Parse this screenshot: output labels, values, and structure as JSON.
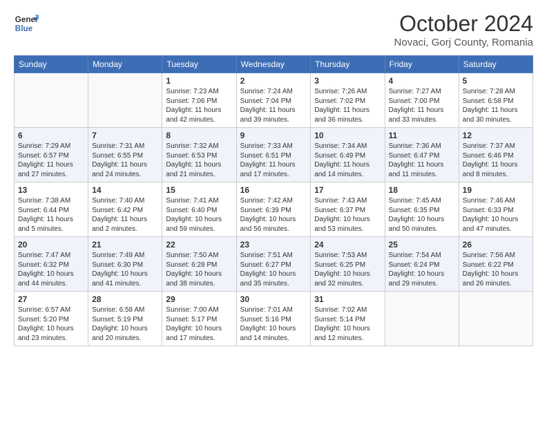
{
  "header": {
    "logo_line1": "General",
    "logo_line2": "Blue",
    "month": "October 2024",
    "location": "Novaci, Gorj County, Romania"
  },
  "weekdays": [
    "Sunday",
    "Monday",
    "Tuesday",
    "Wednesday",
    "Thursday",
    "Friday",
    "Saturday"
  ],
  "rows": [
    [
      {
        "day": "",
        "sunrise": "",
        "sunset": "",
        "daylight": ""
      },
      {
        "day": "",
        "sunrise": "",
        "sunset": "",
        "daylight": ""
      },
      {
        "day": "1",
        "sunrise": "Sunrise: 7:23 AM",
        "sunset": "Sunset: 7:06 PM",
        "daylight": "Daylight: 11 hours and 42 minutes."
      },
      {
        "day": "2",
        "sunrise": "Sunrise: 7:24 AM",
        "sunset": "Sunset: 7:04 PM",
        "daylight": "Daylight: 11 hours and 39 minutes."
      },
      {
        "day": "3",
        "sunrise": "Sunrise: 7:26 AM",
        "sunset": "Sunset: 7:02 PM",
        "daylight": "Daylight: 11 hours and 36 minutes."
      },
      {
        "day": "4",
        "sunrise": "Sunrise: 7:27 AM",
        "sunset": "Sunset: 7:00 PM",
        "daylight": "Daylight: 11 hours and 33 minutes."
      },
      {
        "day": "5",
        "sunrise": "Sunrise: 7:28 AM",
        "sunset": "Sunset: 6:58 PM",
        "daylight": "Daylight: 11 hours and 30 minutes."
      }
    ],
    [
      {
        "day": "6",
        "sunrise": "Sunrise: 7:29 AM",
        "sunset": "Sunset: 6:57 PM",
        "daylight": "Daylight: 11 hours and 27 minutes."
      },
      {
        "day": "7",
        "sunrise": "Sunrise: 7:31 AM",
        "sunset": "Sunset: 6:55 PM",
        "daylight": "Daylight: 11 hours and 24 minutes."
      },
      {
        "day": "8",
        "sunrise": "Sunrise: 7:32 AM",
        "sunset": "Sunset: 6:53 PM",
        "daylight": "Daylight: 11 hours and 21 minutes."
      },
      {
        "day": "9",
        "sunrise": "Sunrise: 7:33 AM",
        "sunset": "Sunset: 6:51 PM",
        "daylight": "Daylight: 11 hours and 17 minutes."
      },
      {
        "day": "10",
        "sunrise": "Sunrise: 7:34 AM",
        "sunset": "Sunset: 6:49 PM",
        "daylight": "Daylight: 11 hours and 14 minutes."
      },
      {
        "day": "11",
        "sunrise": "Sunrise: 7:36 AM",
        "sunset": "Sunset: 6:47 PM",
        "daylight": "Daylight: 11 hours and 11 minutes."
      },
      {
        "day": "12",
        "sunrise": "Sunrise: 7:37 AM",
        "sunset": "Sunset: 6:46 PM",
        "daylight": "Daylight: 11 hours and 8 minutes."
      }
    ],
    [
      {
        "day": "13",
        "sunrise": "Sunrise: 7:38 AM",
        "sunset": "Sunset: 6:44 PM",
        "daylight": "Daylight: 11 hours and 5 minutes."
      },
      {
        "day": "14",
        "sunrise": "Sunrise: 7:40 AM",
        "sunset": "Sunset: 6:42 PM",
        "daylight": "Daylight: 11 hours and 2 minutes."
      },
      {
        "day": "15",
        "sunrise": "Sunrise: 7:41 AM",
        "sunset": "Sunset: 6:40 PM",
        "daylight": "Daylight: 10 hours and 59 minutes."
      },
      {
        "day": "16",
        "sunrise": "Sunrise: 7:42 AM",
        "sunset": "Sunset: 6:39 PM",
        "daylight": "Daylight: 10 hours and 56 minutes."
      },
      {
        "day": "17",
        "sunrise": "Sunrise: 7:43 AM",
        "sunset": "Sunset: 6:37 PM",
        "daylight": "Daylight: 10 hours and 53 minutes."
      },
      {
        "day": "18",
        "sunrise": "Sunrise: 7:45 AM",
        "sunset": "Sunset: 6:35 PM",
        "daylight": "Daylight: 10 hours and 50 minutes."
      },
      {
        "day": "19",
        "sunrise": "Sunrise: 7:46 AM",
        "sunset": "Sunset: 6:33 PM",
        "daylight": "Daylight: 10 hours and 47 minutes."
      }
    ],
    [
      {
        "day": "20",
        "sunrise": "Sunrise: 7:47 AM",
        "sunset": "Sunset: 6:32 PM",
        "daylight": "Daylight: 10 hours and 44 minutes."
      },
      {
        "day": "21",
        "sunrise": "Sunrise: 7:49 AM",
        "sunset": "Sunset: 6:30 PM",
        "daylight": "Daylight: 10 hours and 41 minutes."
      },
      {
        "day": "22",
        "sunrise": "Sunrise: 7:50 AM",
        "sunset": "Sunset: 6:28 PM",
        "daylight": "Daylight: 10 hours and 38 minutes."
      },
      {
        "day": "23",
        "sunrise": "Sunrise: 7:51 AM",
        "sunset": "Sunset: 6:27 PM",
        "daylight": "Daylight: 10 hours and 35 minutes."
      },
      {
        "day": "24",
        "sunrise": "Sunrise: 7:53 AM",
        "sunset": "Sunset: 6:25 PM",
        "daylight": "Daylight: 10 hours and 32 minutes."
      },
      {
        "day": "25",
        "sunrise": "Sunrise: 7:54 AM",
        "sunset": "Sunset: 6:24 PM",
        "daylight": "Daylight: 10 hours and 29 minutes."
      },
      {
        "day": "26",
        "sunrise": "Sunrise: 7:56 AM",
        "sunset": "Sunset: 6:22 PM",
        "daylight": "Daylight: 10 hours and 26 minutes."
      }
    ],
    [
      {
        "day": "27",
        "sunrise": "Sunrise: 6:57 AM",
        "sunset": "Sunset: 5:20 PM",
        "daylight": "Daylight: 10 hours and 23 minutes."
      },
      {
        "day": "28",
        "sunrise": "Sunrise: 6:58 AM",
        "sunset": "Sunset: 5:19 PM",
        "daylight": "Daylight: 10 hours and 20 minutes."
      },
      {
        "day": "29",
        "sunrise": "Sunrise: 7:00 AM",
        "sunset": "Sunset: 5:17 PM",
        "daylight": "Daylight: 10 hours and 17 minutes."
      },
      {
        "day": "30",
        "sunrise": "Sunrise: 7:01 AM",
        "sunset": "Sunset: 5:16 PM",
        "daylight": "Daylight: 10 hours and 14 minutes."
      },
      {
        "day": "31",
        "sunrise": "Sunrise: 7:02 AM",
        "sunset": "Sunset: 5:14 PM",
        "daylight": "Daylight: 10 hours and 12 minutes."
      },
      {
        "day": "",
        "sunrise": "",
        "sunset": "",
        "daylight": ""
      },
      {
        "day": "",
        "sunrise": "",
        "sunset": "",
        "daylight": ""
      }
    ]
  ]
}
